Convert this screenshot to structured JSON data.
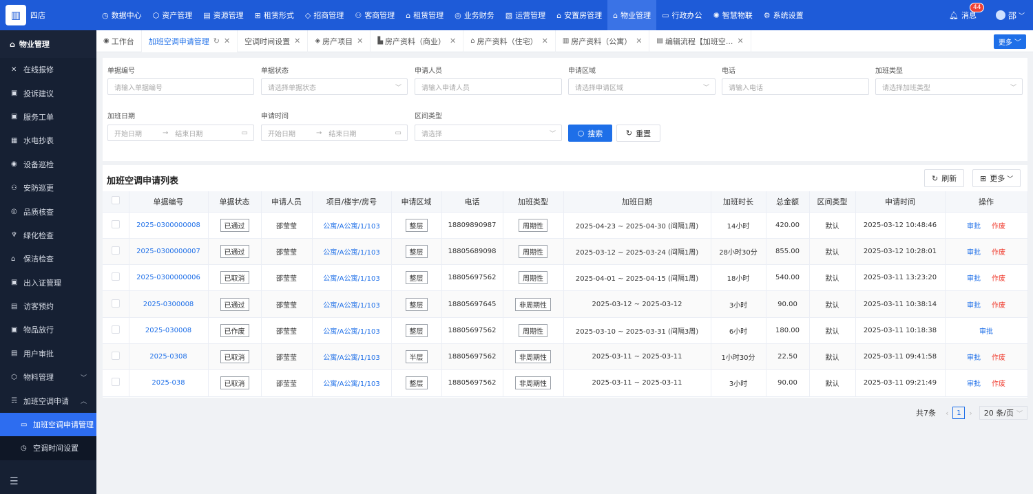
{
  "brand": {
    "logo_icon": "building-icon",
    "name": "四店"
  },
  "nav": [
    {
      "icon": "dashboard-icon",
      "glyph": "◷",
      "label": "数据中心"
    },
    {
      "icon": "cube-icon",
      "glyph": "⬡",
      "label": "资产管理"
    },
    {
      "icon": "doc-icon",
      "glyph": "▤",
      "label": "资源管理"
    },
    {
      "icon": "grid-icon",
      "glyph": "⊞",
      "label": "租赁形式"
    },
    {
      "icon": "tag-icon",
      "glyph": "◇",
      "label": "招商管理"
    },
    {
      "icon": "users-icon",
      "glyph": "⚇",
      "label": "客商管理"
    },
    {
      "icon": "house-icon",
      "glyph": "⌂",
      "label": "租赁管理"
    },
    {
      "icon": "money-icon",
      "glyph": "◎",
      "label": "业务财务"
    },
    {
      "icon": "ops-icon",
      "glyph": "▧",
      "label": "运营管理"
    },
    {
      "icon": "home-icon",
      "glyph": "⌂",
      "label": "安置房管理"
    },
    {
      "icon": "property-icon",
      "glyph": "⌂",
      "label": "物业管理"
    },
    {
      "icon": "office-icon",
      "glyph": "▭",
      "label": "行政办公"
    },
    {
      "icon": "iot-icon",
      "glyph": "✺",
      "label": "智慧物联"
    },
    {
      "icon": "gear-icon",
      "glyph": "⚙",
      "label": "系统设置"
    }
  ],
  "nav_active_index": 10,
  "top_right": {
    "message_label": "消息",
    "message_count": "44",
    "user_name": "邵"
  },
  "sidebar": {
    "header": "物业管理",
    "items": [
      {
        "icon": "wrench-icon",
        "glyph": "✕",
        "label": "在线报修"
      },
      {
        "icon": "feedback-icon",
        "glyph": "▣",
        "label": "投诉建议"
      },
      {
        "icon": "ticket-icon",
        "glyph": "▣",
        "label": "服务工单"
      },
      {
        "icon": "meter-icon",
        "glyph": "▦",
        "label": "水电抄表"
      },
      {
        "icon": "patrol-icon",
        "glyph": "◉",
        "label": "设备巡检"
      },
      {
        "icon": "guard-icon",
        "glyph": "⚇",
        "label": "安防巡更"
      },
      {
        "icon": "quality-icon",
        "glyph": "◎",
        "label": "品质核查"
      },
      {
        "icon": "plant-icon",
        "glyph": "♆",
        "label": "绿化检查"
      },
      {
        "icon": "clean-icon",
        "glyph": "⌂",
        "label": "保洁检查"
      },
      {
        "icon": "pass-icon",
        "glyph": "▣",
        "label": "出入证管理"
      },
      {
        "icon": "visitor-icon",
        "glyph": "▤",
        "label": "访客预约"
      },
      {
        "icon": "goods-icon",
        "glyph": "▣",
        "label": "物品放行"
      },
      {
        "icon": "audit-icon",
        "glyph": "▤",
        "label": "用户审批"
      },
      {
        "icon": "material-icon",
        "glyph": "⬡",
        "label": "物料管理",
        "arrow": "﹀"
      },
      {
        "icon": "aircon-icon",
        "glyph": "☴",
        "label": "加班空调申请",
        "arrow": "︿"
      }
    ],
    "sub_items": [
      {
        "icon": "aircon-apply-icon",
        "glyph": "▭",
        "label": "加班空调申请管理",
        "active": true
      },
      {
        "icon": "clock-icon",
        "glyph": "◷",
        "label": "空调时间设置",
        "active": false
      }
    ]
  },
  "tabs": [
    {
      "icon": "workbench-icon",
      "glyph": "◉",
      "label": "工作台",
      "closable": false
    },
    {
      "icon": "",
      "glyph": "",
      "label": "加班空调申请管理",
      "closable": true,
      "active": true
    },
    {
      "icon": "",
      "glyph": "",
      "label": "空调时间设置",
      "closable": true
    },
    {
      "icon": "layers-icon",
      "glyph": "◈",
      "label": "房产项目",
      "closable": true
    },
    {
      "icon": "shop-icon",
      "glyph": "▙",
      "label": "房产资料（商业）",
      "closable": true
    },
    {
      "icon": "house-icon",
      "glyph": "⌂",
      "label": "房产资料（住宅）",
      "closable": true
    },
    {
      "icon": "apartment-icon",
      "glyph": "▥",
      "label": "房产资料（公寓）",
      "closable": true
    },
    {
      "icon": "flow-icon",
      "glyph": "▤",
      "label": "编辑流程【加班空...",
      "closable": true
    }
  ],
  "tabs_more": "更多",
  "filters": {
    "doc_no": {
      "label": "单据编号",
      "placeholder": "请输入单据编号"
    },
    "status": {
      "label": "单据状态",
      "placeholder": "请选择单据状态"
    },
    "applicant": {
      "label": "申请人员",
      "placeholder": "请输入申请人员"
    },
    "area": {
      "label": "申请区域",
      "placeholder": "请选择申请区域"
    },
    "phone": {
      "label": "电话",
      "placeholder": "请输入电话"
    },
    "ot_type": {
      "label": "加班类型",
      "placeholder": "请选择加班类型"
    },
    "ot_date": {
      "label": "加班日期",
      "start": "开始日期",
      "end": "结束日期"
    },
    "apply_time": {
      "label": "申请时间",
      "start": "开始日期",
      "end": "结束日期"
    },
    "range_type": {
      "label": "区间类型",
      "placeholder": "请选择"
    },
    "search_label": "搜索",
    "reset_label": "重置"
  },
  "panel": {
    "title": "加班空调申请列表",
    "refresh_label": "刷新",
    "more_label": "更多",
    "columns": [
      "单据编号",
      "单据状态",
      "申请人员",
      "项目/楼宇/房号",
      "申请区域",
      "电话",
      "加班类型",
      "加班日期",
      "加班时长",
      "总金额",
      "区间类型",
      "申请时间",
      "操作"
    ],
    "rows": [
      {
        "no": "2025-0300000008",
        "status": "已通过",
        "applicant": "邵莹莹",
        "room": "公寓/A公寓/1/103",
        "area": "整层",
        "phone": "18809890987",
        "type": "周期性",
        "date": "2025-04-23 ~ 2025-04-30 (间隔1周)",
        "duration": "14小时",
        "amount": "420.00",
        "range": "默认",
        "time": "2025-03-12 10:48:46",
        "ops": [
          "审批",
          "作废"
        ]
      },
      {
        "no": "2025-0300000007",
        "status": "已通过",
        "applicant": "邵莹莹",
        "room": "公寓/A公寓/1/103",
        "area": "整层",
        "phone": "18805689098",
        "type": "周期性",
        "date": "2025-03-12 ~ 2025-03-24 (间隔1周)",
        "duration": "28小时30分",
        "amount": "855.00",
        "range": "默认",
        "time": "2025-03-12 10:28:01",
        "ops": [
          "审批",
          "作废"
        ]
      },
      {
        "no": "2025-0300000006",
        "status": "已取消",
        "applicant": "邵莹莹",
        "room": "公寓/A公寓/1/103",
        "area": "整层",
        "phone": "18805697562",
        "type": "周期性",
        "date": "2025-04-01 ~ 2025-04-15 (间隔1周)",
        "duration": "18小时",
        "amount": "540.00",
        "range": "默认",
        "time": "2025-03-11 13:23:20",
        "ops": [
          "审批",
          "作废"
        ]
      },
      {
        "no": "2025-0300008",
        "status": "已通过",
        "applicant": "邵莹莹",
        "room": "公寓/A公寓/1/103",
        "area": "整层",
        "phone": "18805697645",
        "type": "非周期性",
        "date": "2025-03-12 ~ 2025-03-12",
        "duration": "3小时",
        "amount": "90.00",
        "range": "默认",
        "time": "2025-03-11 10:38:14",
        "ops": [
          "审批",
          "作废"
        ]
      },
      {
        "no": "2025-030008",
        "status": "已作废",
        "applicant": "邵莹莹",
        "room": "公寓/A公寓/1/103",
        "area": "整层",
        "phone": "18805697562",
        "type": "周期性",
        "date": "2025-03-10 ~ 2025-03-31 (间隔3周)",
        "duration": "6小时",
        "amount": "180.00",
        "range": "默认",
        "time": "2025-03-11 10:18:38",
        "ops": [
          "审批"
        ]
      },
      {
        "no": "2025-0308",
        "status": "已取消",
        "applicant": "邵莹莹",
        "room": "公寓/A公寓/1/103",
        "area": "半层",
        "phone": "18805697562",
        "type": "非周期性",
        "date": "2025-03-11 ~ 2025-03-11",
        "duration": "1小时30分",
        "amount": "22.50",
        "range": "默认",
        "time": "2025-03-11 09:41:58",
        "ops": [
          "审批",
          "作废"
        ]
      },
      {
        "no": "2025-038",
        "status": "已取消",
        "applicant": "邵莹莹",
        "room": "公寓/A公寓/1/103",
        "area": "整层",
        "phone": "18805697562",
        "type": "非周期性",
        "date": "2025-03-11 ~ 2025-03-11",
        "duration": "3小时",
        "amount": "90.00",
        "range": "默认",
        "time": "2025-03-11 09:21:49",
        "ops": [
          "审批",
          "作废"
        ]
      }
    ]
  },
  "pager": {
    "total": "共7条",
    "current": "1",
    "page_size": "20 条/页"
  }
}
